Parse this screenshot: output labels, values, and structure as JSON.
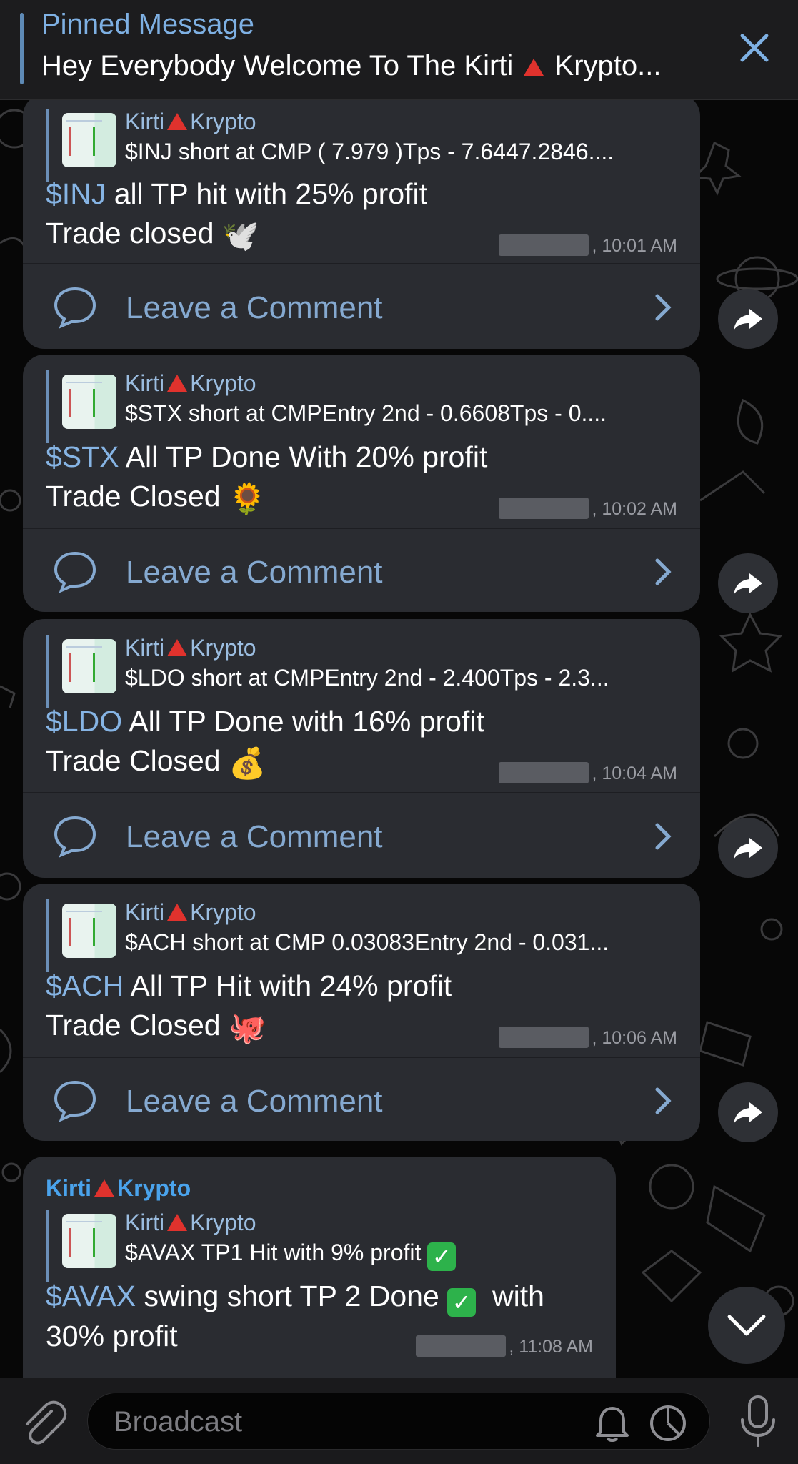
{
  "pinned": {
    "title": "Pinned Message",
    "text_before": "Hey Everybody Welcome To The Kirti",
    "text_after": "Krypto..."
  },
  "channel": {
    "name_first": "Kirti",
    "name_last": "Krypto"
  },
  "comment_label": "Leave a Comment",
  "messages": [
    {
      "reply_text": "$INJ short at CMP ( 7.979 )Tps - 7.6447.2846....",
      "tag": "$INJ",
      "line1": "all TP hit with 25% profit",
      "line2": "Trade closed",
      "emoji": "🕊️",
      "time": ", 10:01 AM"
    },
    {
      "reply_text": "$STX short at CMPEntry 2nd - 0.6608Tps - 0....",
      "tag": "$STX",
      "line1": "All TP Done With 20% profit",
      "line2": "Trade Closed",
      "emoji": "🌻",
      "time": ", 10:02 AM"
    },
    {
      "reply_text": "$LDO short at CMPEntry 2nd - 2.400Tps - 2.3...",
      "tag": "$LDO",
      "line1": "All TP Done with 16% profit",
      "line2": "Trade Closed",
      "emoji": "💰",
      "time": ", 10:04 AM"
    },
    {
      "reply_text": "$ACH short at CMP 0.03083Entry 2nd - 0.031...",
      "tag": "$ACH",
      "line1": "All TP Hit with 24% profit",
      "line2": "Trade Closed",
      "emoji": "🐙",
      "time": ", 10:06 AM"
    }
  ],
  "last_message": {
    "sender_first": "Kirti",
    "sender_last": "Krypto",
    "reply_text": "$AVAX TP1 Hit with 9% profit",
    "tag": "$AVAX",
    "line1_a": "swing short TP 2 Done",
    "line1_b": "with",
    "line2": "30% profit",
    "time": ", 11:08 AM"
  },
  "input": {
    "placeholder": "Broadcast"
  },
  "colors": {
    "accent": "#86b4e4",
    "bubble": "#2a2c31",
    "sender": "#4aa3ec",
    "check": "#2db24b"
  }
}
